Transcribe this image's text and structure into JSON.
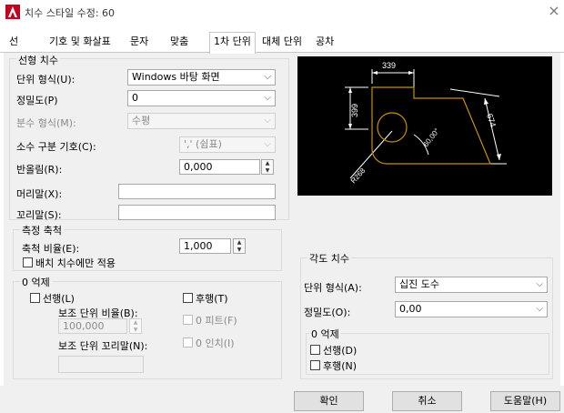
{
  "window": {
    "title": "치수 스타일 수정: 60",
    "close_glyph": "×"
  },
  "tabs": [
    "선",
    "기호 및 화살표",
    "문자",
    "맞춤",
    "1차 단위",
    "대체 단위",
    "공차"
  ],
  "linear": {
    "group_label": "선형 치수",
    "unit_format_label": "단위 형식(U):",
    "unit_format_value": "Windows 바탕 화면",
    "precision_label": "정밀도(P)",
    "precision_value": "0",
    "fraction_label": "분수 형식(M):",
    "fraction_value": "수평",
    "decimal_sep_label": "소수 구분 기호(C):",
    "decimal_sep_value": "','  (쉼표)",
    "roundoff_label": "반올림(R):",
    "roundoff_value": "0,000",
    "prefix_label": "머리말(X):",
    "prefix_value": "",
    "suffix_label": "꼬리말(S):",
    "suffix_value": ""
  },
  "scale": {
    "group_label": "측정 축척",
    "factor_label": "축척 비율(E):",
    "factor_value": "1,000",
    "layout_only_label": "배치 치수에만 적용"
  },
  "zero_suppress_linear": {
    "group_label": "0 억제",
    "leading_label": "선행(L)",
    "trailing_label": "후행(T)",
    "sub_factor_label": "보조 단위 비율(B):",
    "sub_factor_value": "100,000",
    "zero_feet_label": "0 피트(F)",
    "sub_suffix_label": "보조 단위 꼬리말(N):",
    "zero_inch_label": "0 인치(I)",
    "sub_suffix_value": ""
  },
  "angular": {
    "group_label": "각도 치수",
    "unit_format_label": "단위 형식(A):",
    "unit_format_value": "십진 도수",
    "precision_label": "정밀도(O):",
    "precision_value": "0,00",
    "zero_group_label": "0 억제",
    "leading_label": "선행(D)",
    "trailing_label": "후행(N)"
  },
  "preview": {
    "dim_top": "339",
    "dim_left": "399",
    "dim_diag": "674",
    "dim_angle": "60,00°",
    "dim_radius": "R268",
    "line_color": "#ffffff",
    "shape_color": "#c89100"
  },
  "buttons": {
    "ok": "확인",
    "cancel": "취소",
    "help": "도움말(H)"
  },
  "colors": {
    "accent": "#c8001e",
    "panel": "#f0f0f0"
  }
}
